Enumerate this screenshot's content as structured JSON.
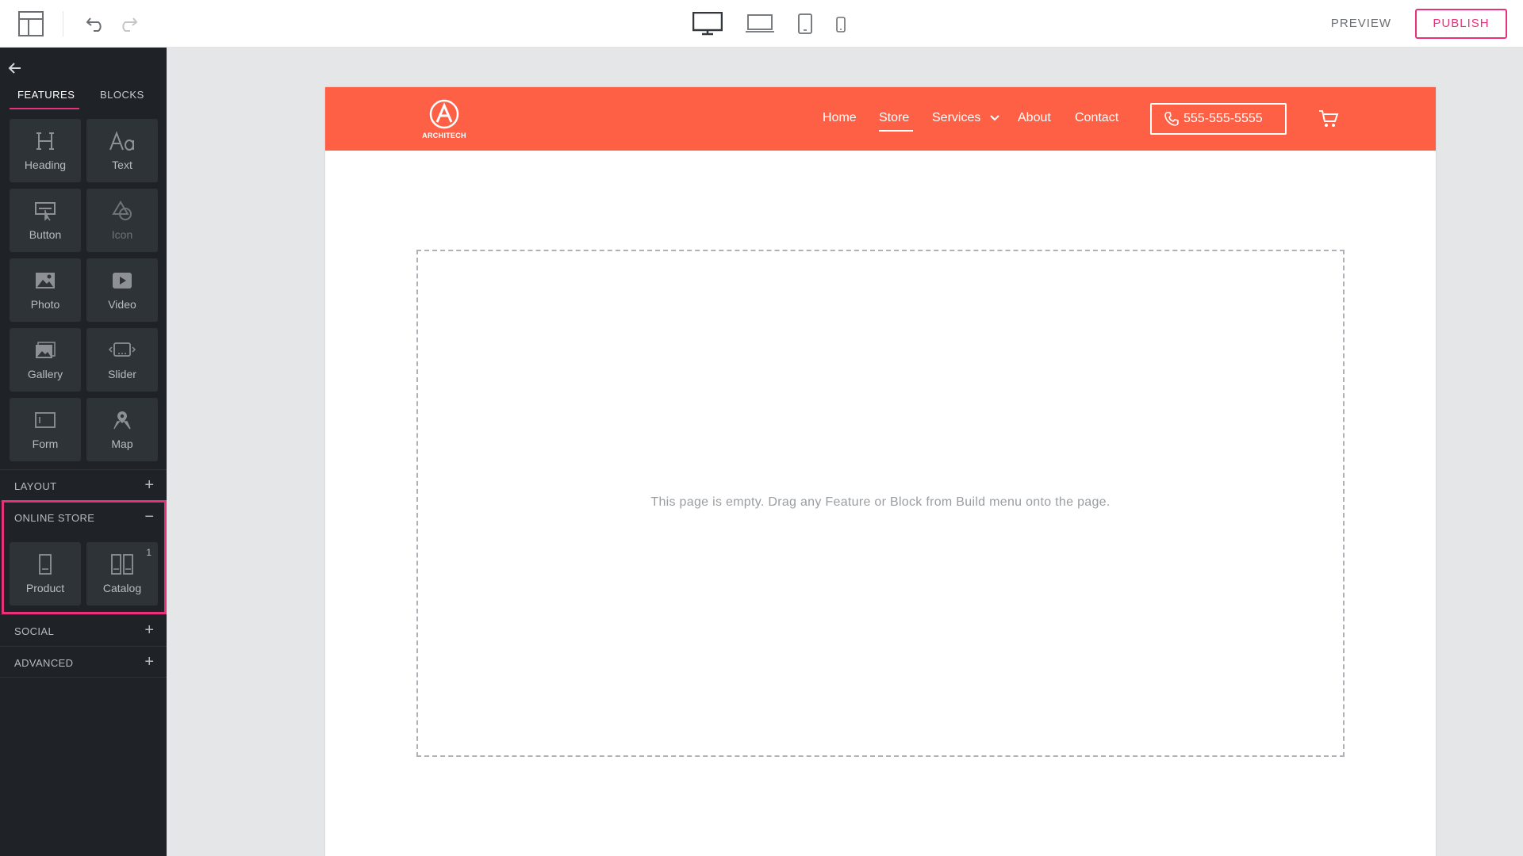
{
  "toolbar": {
    "preview_label": "PREVIEW",
    "publish_label": "PUBLISH",
    "icons": [
      "layout-icon",
      "undo-icon",
      "redo-icon",
      "desktop-icon",
      "laptop-icon",
      "tablet-icon",
      "mobile-icon"
    ]
  },
  "sidebar": {
    "tabs": [
      {
        "label": "FEATURES",
        "active": true
      },
      {
        "label": "BLOCKS",
        "active": false
      }
    ],
    "features": [
      {
        "label": "Heading",
        "icon": "heading-icon"
      },
      {
        "label": "Text",
        "icon": "text-icon"
      },
      {
        "label": "Button",
        "icon": "button-icon"
      },
      {
        "label": "Icon",
        "icon": "shapes-icon",
        "disabled": true
      },
      {
        "label": "Photo",
        "icon": "photo-icon"
      },
      {
        "label": "Video",
        "icon": "video-icon"
      },
      {
        "label": "Gallery",
        "icon": "gallery-icon"
      },
      {
        "label": "Slider",
        "icon": "slider-icon"
      },
      {
        "label": "Form",
        "icon": "form-icon"
      },
      {
        "label": "Map",
        "icon": "map-icon"
      }
    ],
    "sections": [
      {
        "label": "LAYOUT",
        "toggle": "+"
      },
      {
        "label": "ONLINE STORE",
        "toggle": "−"
      },
      {
        "label": "SOCIAL",
        "toggle": "+"
      },
      {
        "label": "ADVANCED",
        "toggle": "+"
      }
    ],
    "store_items": [
      {
        "label": "Product",
        "icon": "product-icon"
      },
      {
        "label": "Catalog",
        "icon": "catalog-icon",
        "badge": "1"
      }
    ]
  },
  "site": {
    "logo_text": "ARCHITECH",
    "nav": [
      "Home",
      "Store",
      "Services",
      "About",
      "Contact"
    ],
    "active_nav": "Store",
    "phone": "555-555-5555",
    "header_color": "#fe6045"
  },
  "canvas": {
    "empty_message": "This page is empty. Drag any Feature or Block from Build menu onto the page."
  },
  "colors": {
    "accent": "#e8317a",
    "sidebar_bg": "#1f2327"
  }
}
